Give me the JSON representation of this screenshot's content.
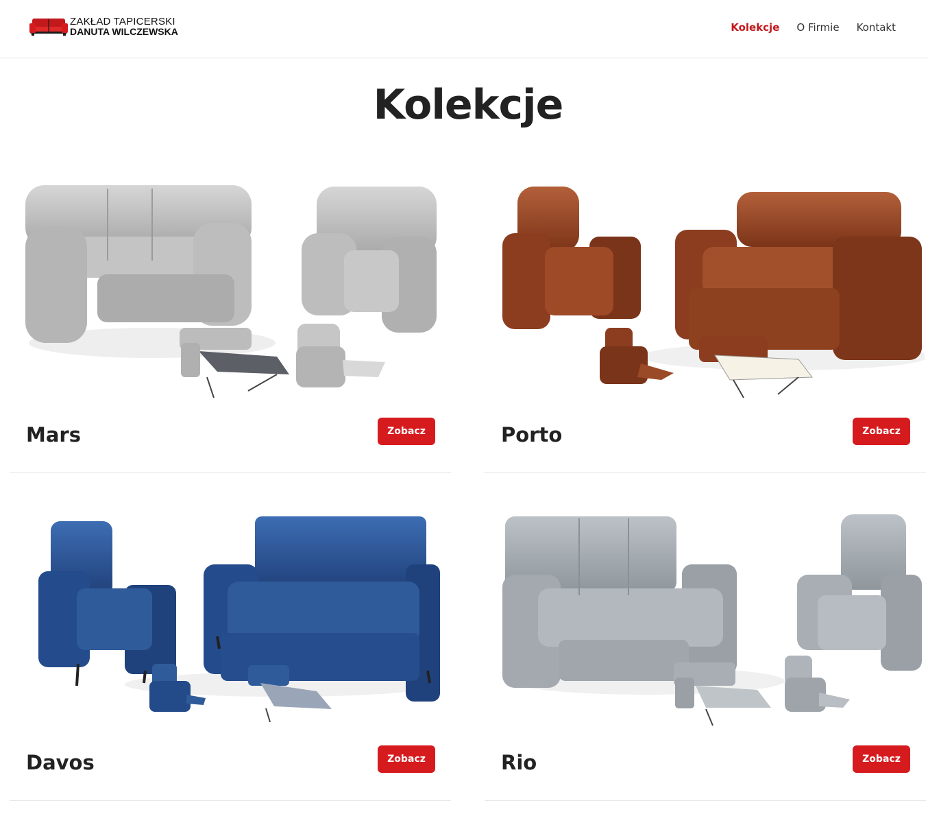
{
  "header": {
    "logo_line1": "ZAKŁAD TAPICERSKI",
    "logo_line2": "DANUTA WILCZEWSKA",
    "nav": [
      {
        "label": "Kolekcje",
        "active": true
      },
      {
        "label": "O Firmie",
        "active": false
      },
      {
        "label": "Kontakt",
        "active": false
      }
    ]
  },
  "page": {
    "title": "Kolekcje"
  },
  "collections": [
    {
      "name": "Mars",
      "button": "Zobacz",
      "color": "#c9c9c9"
    },
    {
      "name": "Porto",
      "button": "Zobacz",
      "color": "#9a4a2c"
    },
    {
      "name": "Davos",
      "button": "Zobacz",
      "color": "#2f5b9a"
    },
    {
      "name": "Rio",
      "button": "Zobacz",
      "color": "#aab0b5"
    }
  ],
  "colors": {
    "accent": "#d61b1f",
    "nav_active": "#c2191c",
    "text": "#222222"
  }
}
